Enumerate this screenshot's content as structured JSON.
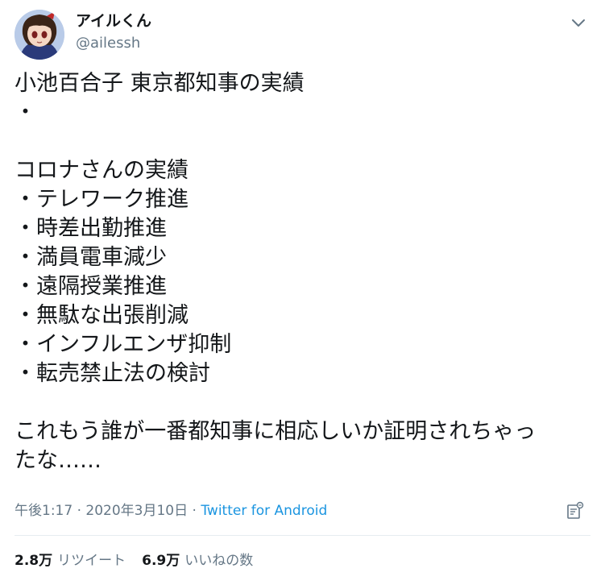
{
  "user": {
    "display_name": "アイルくん",
    "handle": "@ailessh"
  },
  "icons": {
    "avatar": "anime-character-avatar",
    "caret": "chevron-down-icon",
    "analytics": "analytics-icon"
  },
  "tweet": {
    "lines": [
      "小池百合子 東京都知事の実績",
      "・",
      "",
      "コロナさんの実績",
      "・テレワーク推進",
      "・時差出勤推進",
      "・満員電車減少",
      "・遠隔授業推進",
      "・無駄な出張削減",
      "・インフルエンザ抑制",
      "・転売禁止法の検討",
      "",
      "これもう誰が一番都知事に相応しいか証明されちゃっ",
      "たな……"
    ]
  },
  "meta": {
    "time": "午後1:17",
    "separator1": " · ",
    "date": "2020年3月10日",
    "separator2": " · ",
    "source": "Twitter for Android"
  },
  "stats": {
    "retweets_count": "2.8万",
    "retweets_label": "リツイート",
    "likes_count": "6.9万",
    "likes_label": "いいねの数"
  },
  "colors": {
    "text": "#14171a",
    "secondary": "#657786",
    "link": "#1b95e0",
    "divider": "#e6ecf0"
  }
}
